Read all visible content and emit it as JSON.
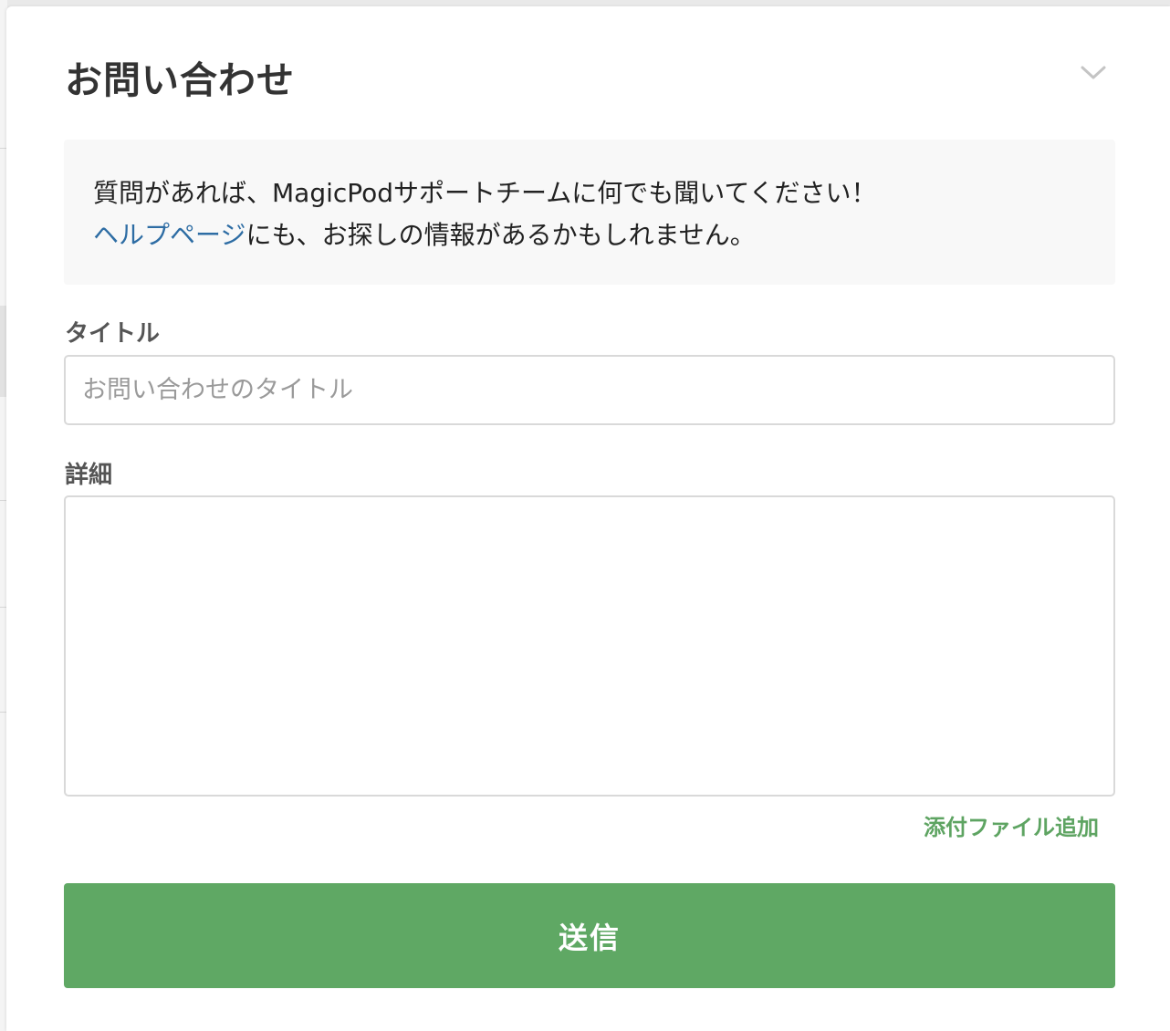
{
  "dialog": {
    "title": "お問い合わせ",
    "collapse_icon": "chevron-down-icon"
  },
  "info": {
    "line1": "質問があれば、MagicPodサポートチームに何でも聞いてください！",
    "help_link": "ヘルプページ",
    "line2_rest": "にも、お探しの情報があるかもしれません。"
  },
  "form": {
    "title_label": "タイトル",
    "title_placeholder": "お問い合わせのタイトル",
    "title_value": "",
    "detail_label": "詳細",
    "detail_value": "",
    "attach_label": "添付ファイル追加",
    "submit_label": "送信"
  },
  "colors": {
    "accent_green": "#5fa864",
    "link_blue": "#2e6da4",
    "info_bg": "#f8f8f8"
  }
}
